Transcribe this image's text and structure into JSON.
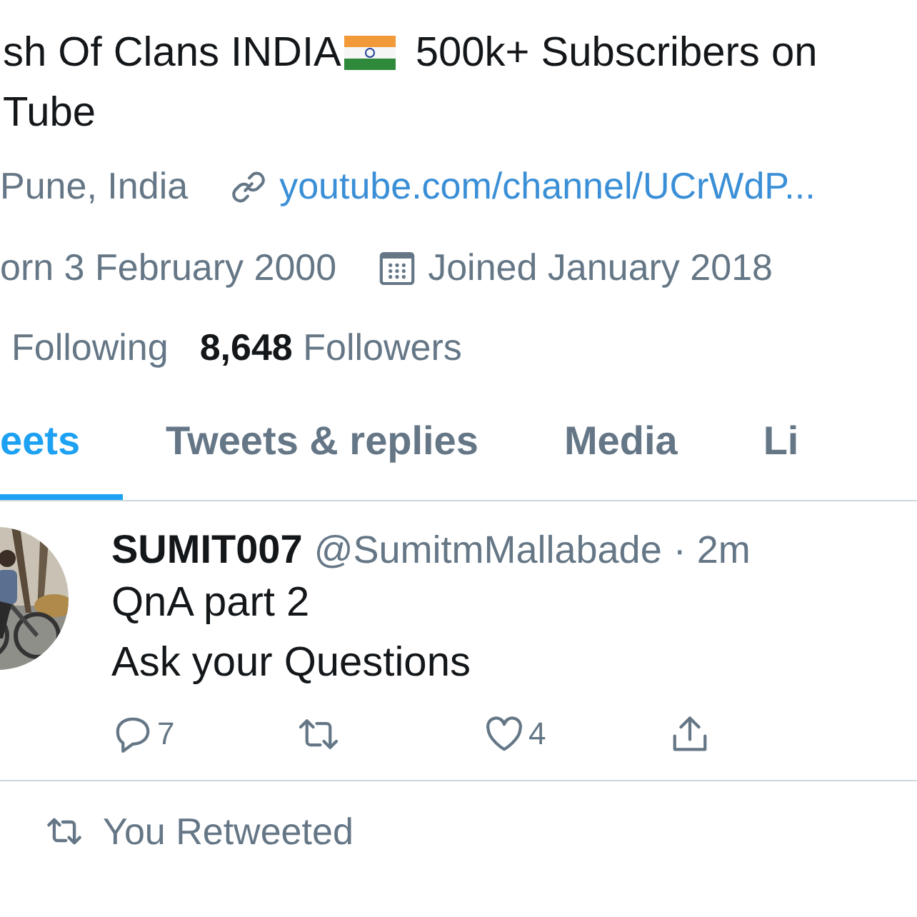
{
  "bio": {
    "line_1_start": "sh Of Clans INDIA",
    "line_1_end": "500k+ Subscribers on",
    "line_2": "Tube"
  },
  "location": "Pune, India",
  "link": "youtube.com/channel/UCrWdP...",
  "birthday": "orn 3 February 2000",
  "joined": "Joined January 2018",
  "following": {
    "label": "Following"
  },
  "followers": {
    "count": "8,648",
    "label": "Followers"
  },
  "tabs": [
    {
      "label": "eets",
      "selected": true
    },
    {
      "label": "Tweets & replies",
      "selected": false
    },
    {
      "label": "Media",
      "selected": false
    },
    {
      "label": "Li",
      "selected": false
    }
  ],
  "tweet": {
    "name": "SUMIT007",
    "handle": "@SumitmMallabade",
    "time": "· 2m",
    "lines": [
      "QnA part 2",
      "Ask your Questions"
    ],
    "actions": [
      {
        "kind": "reply",
        "count": "7"
      },
      {
        "kind": "retweet"
      },
      {
        "kind": "like",
        "count": "4"
      },
      {
        "kind": "share"
      }
    ]
  },
  "next_tweet": {
    "context": "You Retweeted"
  }
}
